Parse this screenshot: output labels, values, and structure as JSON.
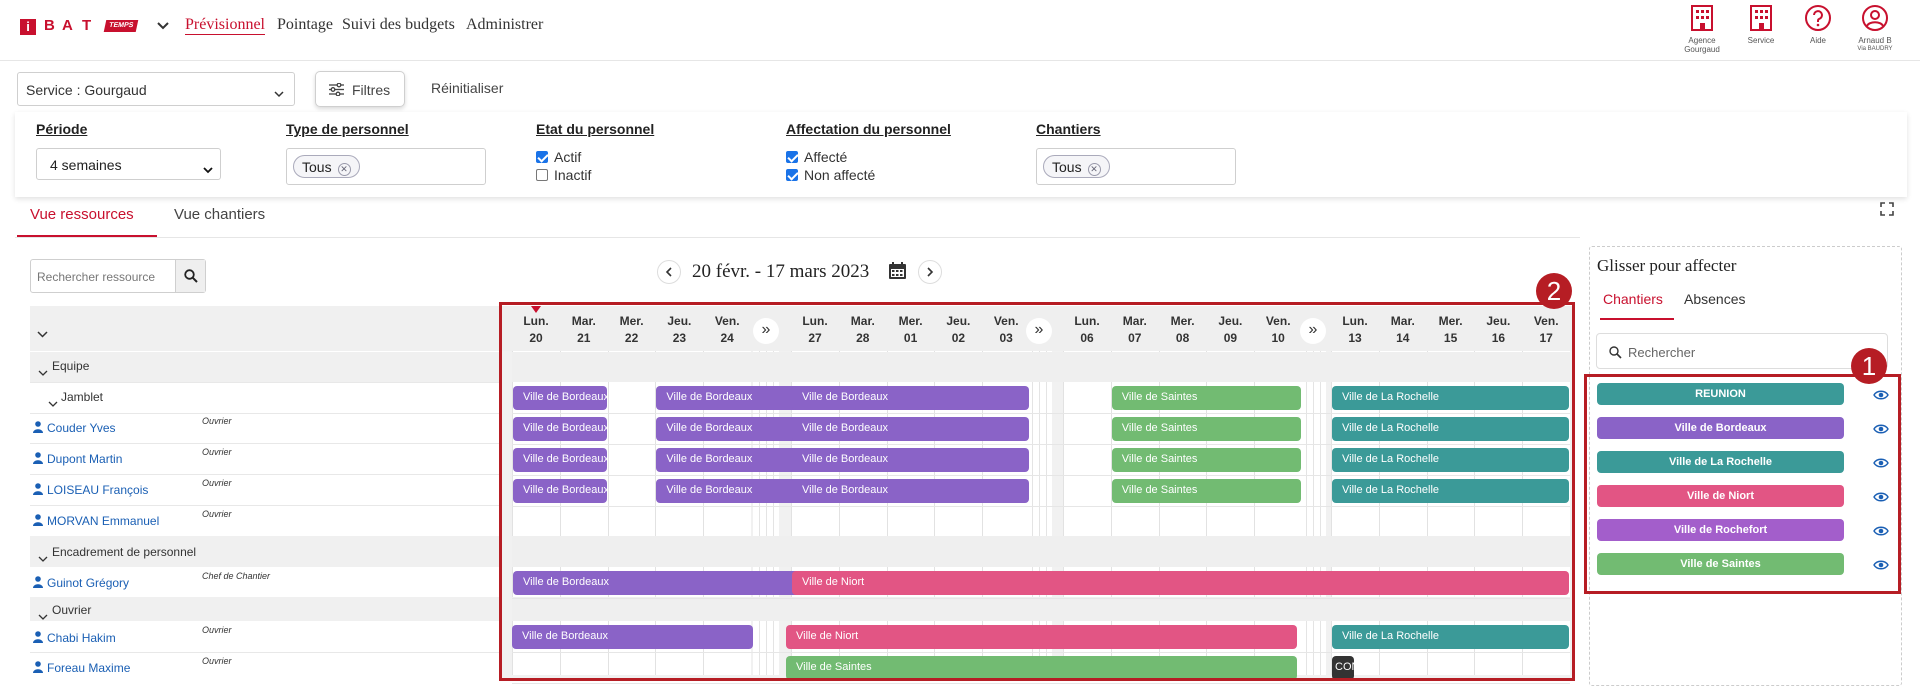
{
  "header": {
    "logo_letters": [
      "i",
      "B",
      "A",
      "T"
    ],
    "logo_tag": "TEMPS",
    "nav": [
      {
        "label": "Prévisionnel",
        "active": true
      },
      {
        "label": "Pointage"
      },
      {
        "label": "Suivi des budgets"
      },
      {
        "label": "Administrer"
      }
    ],
    "icons": [
      {
        "name": "building-icon",
        "label_lines": [
          "Agence",
          "Gourgaud"
        ]
      },
      {
        "name": "building-icon",
        "label_lines": [
          "Service",
          ""
        ]
      },
      {
        "name": "help-icon",
        "label_lines": [
          "Aide",
          ""
        ]
      },
      {
        "name": "user-icon",
        "label_lines": [
          "Arnaud B",
          "Via BAUDRY"
        ]
      }
    ]
  },
  "filters": {
    "service_select": "Service : Gourgaud",
    "filter_button": "Filtres",
    "reset_button": "Réinitialiser",
    "periode": {
      "label": "Période",
      "value": "4 semaines"
    },
    "type_personnel": {
      "label": "Type de personnel",
      "chip": "Tous"
    },
    "etat_personnel": {
      "label": "Etat du personnel",
      "options": [
        {
          "label": "Actif",
          "checked": true
        },
        {
          "label": "Inactif",
          "checked": false
        }
      ]
    },
    "affectation": {
      "label": "Affectation du personnel",
      "options": [
        {
          "label": "Affecté",
          "checked": true
        },
        {
          "label": "Non affecté",
          "checked": true
        }
      ]
    },
    "chantiers": {
      "label": "Chantiers",
      "chip": "Tous"
    }
  },
  "tabs": [
    {
      "label": "Vue ressources",
      "active": true
    },
    {
      "label": "Vue chantiers"
    }
  ],
  "resources": {
    "search_placeholder": "Rechercher ressource",
    "groups": [
      {
        "label": "Equipe"
      },
      {
        "label": "Jamblet"
      },
      {
        "label": "Encadrement de personnel"
      },
      {
        "label": "Ouvrier"
      }
    ],
    "people": [
      {
        "name": "Couder Yves",
        "role": "Ouvrier"
      },
      {
        "name": "Dupont Martin",
        "role": "Ouvrier"
      },
      {
        "name": "LOISEAU François",
        "role": "Ouvrier"
      },
      {
        "name": "MORVAN Emmanuel",
        "role": "Ouvrier"
      },
      {
        "name": "Guinot Grégory",
        "role": "Chef de Chantier"
      },
      {
        "name": "Chabi Hakim",
        "role": "Ouvrier"
      },
      {
        "name": "Foreau Maxime",
        "role": "Ouvrier"
      }
    ]
  },
  "calendar": {
    "range_title": "20 févr. - 17 mars 2023",
    "weeks": [
      {
        "days": [
          {
            "d": "Lun.",
            "n": "20"
          },
          {
            "d": "Mar.",
            "n": "21"
          },
          {
            "d": "Mer.",
            "n": "22"
          },
          {
            "d": "Jeu.",
            "n": "23"
          },
          {
            "d": "Ven.",
            "n": "24"
          }
        ]
      },
      {
        "days": [
          {
            "d": "Lun.",
            "n": "27"
          },
          {
            "d": "Mar.",
            "n": "28"
          },
          {
            "d": "Mer.",
            "n": "01"
          },
          {
            "d": "Jeu.",
            "n": "02"
          },
          {
            "d": "Ven.",
            "n": "03"
          }
        ]
      },
      {
        "days": [
          {
            "d": "Lun.",
            "n": "06"
          },
          {
            "d": "Mar.",
            "n": "07"
          },
          {
            "d": "Mer.",
            "n": "08"
          },
          {
            "d": "Jeu.",
            "n": "09"
          },
          {
            "d": "Ven.",
            "n": "10"
          }
        ]
      },
      {
        "days": [
          {
            "d": "Lun.",
            "n": "13"
          },
          {
            "d": "Mar.",
            "n": "14"
          },
          {
            "d": "Mer.",
            "n": "15"
          },
          {
            "d": "Jeu.",
            "n": "16"
          },
          {
            "d": "Ven.",
            "n": "17"
          }
        ]
      }
    ],
    "annotation_grid": "2",
    "assignments": [
      {
        "row": 0,
        "label": "Ville de Bordeaux",
        "color": "#8a63c7",
        "from": [
          0,
          0
        ],
        "to": [
          0,
          1
        ]
      },
      {
        "row": 0,
        "label": "Ville de Bordeaux",
        "color": "#8a63c7",
        "from": [
          0,
          3
        ],
        "to": [
          1,
          0
        ]
      },
      {
        "row": 0,
        "label": "Ville de Bordeaux",
        "color": "#8a63c7",
        "from": [
          1,
          0
        ],
        "to": [
          1,
          4
        ]
      },
      {
        "row": 0,
        "label": "Ville de Saintes",
        "color": "#72bb72",
        "from": [
          2,
          1
        ],
        "to": [
          2,
          4
        ]
      },
      {
        "row": 0,
        "label": "Ville de La Rochelle",
        "color": "#3b9a98",
        "from": [
          3,
          0
        ],
        "to": [
          3,
          4
        ]
      },
      {
        "row": 1,
        "label": "Ville de Bordeaux",
        "color": "#8a63c7",
        "from": [
          0,
          0
        ],
        "to": [
          0,
          1
        ]
      },
      {
        "row": 1,
        "label": "Ville de Bordeaux",
        "color": "#8a63c7",
        "from": [
          0,
          3
        ],
        "to": [
          1,
          0
        ]
      },
      {
        "row": 1,
        "label": "Ville de Bordeaux",
        "color": "#8a63c7",
        "from": [
          1,
          0
        ],
        "to": [
          1,
          4
        ]
      },
      {
        "row": 1,
        "label": "Ville de Saintes",
        "color": "#72bb72",
        "from": [
          2,
          1
        ],
        "to": [
          2,
          4
        ]
      },
      {
        "row": 1,
        "label": "Ville de La Rochelle",
        "color": "#3b9a98",
        "from": [
          3,
          0
        ],
        "to": [
          3,
          4
        ]
      },
      {
        "row": 2,
        "label": "Ville de Bordeaux",
        "color": "#8a63c7",
        "from": [
          0,
          0
        ],
        "to": [
          0,
          1
        ]
      },
      {
        "row": 2,
        "label": "Ville de Bordeaux",
        "color": "#8a63c7",
        "from": [
          0,
          3
        ],
        "to": [
          1,
          0
        ]
      },
      {
        "row": 2,
        "label": "Ville de Bordeaux",
        "color": "#8a63c7",
        "from": [
          1,
          0
        ],
        "to": [
          1,
          4
        ]
      },
      {
        "row": 2,
        "label": "Ville de Saintes",
        "color": "#72bb72",
        "from": [
          2,
          1
        ],
        "to": [
          2,
          4
        ]
      },
      {
        "row": 2,
        "label": "Ville de La Rochelle",
        "color": "#3b9a98",
        "from": [
          3,
          0
        ],
        "to": [
          3,
          4
        ]
      },
      {
        "row": 3,
        "label": "Ville de Bordeaux",
        "color": "#8a63c7",
        "from": [
          0,
          0
        ],
        "to": [
          0,
          1
        ]
      },
      {
        "row": 3,
        "label": "Ville de Bordeaux",
        "color": "#8a63c7",
        "from": [
          0,
          3
        ],
        "to": [
          1,
          0
        ]
      },
      {
        "row": 3,
        "label": "Ville de Bordeaux",
        "color": "#8a63c7",
        "from": [
          1,
          0
        ],
        "to": [
          1,
          4
        ]
      },
      {
        "row": 3,
        "label": "Ville de Saintes",
        "color": "#72bb72",
        "from": [
          2,
          1
        ],
        "to": [
          2,
          4
        ]
      },
      {
        "row": 3,
        "label": "Ville de La Rochelle",
        "color": "#3b9a98",
        "from": [
          3,
          0
        ],
        "to": [
          3,
          4
        ]
      },
      {
        "row": 4,
        "label": "Ville de Bordeaux",
        "color": "#8a63c7",
        "from": [
          0,
          0
        ],
        "to": [
          1,
          0
        ]
      },
      {
        "row": 4,
        "label": "Ville de Niort",
        "color": "#e25584",
        "from": [
          1,
          0
        ],
        "to": [
          3,
          4
        ]
      },
      {
        "row": 5,
        "label": "Ville de Bordeaux",
        "color": "#8a63c7",
        "from": [
          0,
          0
        ],
        "to": [
          0,
          4
        ]
      },
      {
        "row": 5,
        "label": "Ville de Niort",
        "color": "#e25584",
        "from": [
          1,
          0
        ],
        "to": [
          2,
          4
        ]
      },
      {
        "row": 5,
        "label": "Ville de La Rochelle",
        "color": "#3b9a98",
        "from": [
          3,
          0
        ],
        "to": [
          3,
          4
        ]
      },
      {
        "row": 6,
        "label": "Ville de Saintes",
        "color": "#72bb72",
        "from": [
          1,
          0
        ],
        "to": [
          2,
          4
        ]
      },
      {
        "row": 6,
        "label": "CON",
        "color": "#333333",
        "from": [
          3,
          0
        ],
        "to": [
          3,
          0
        ]
      }
    ]
  },
  "right_panel": {
    "title": "Glisser pour affecter",
    "tabs": [
      {
        "label": "Chantiers",
        "active": true
      },
      {
        "label": "Absences"
      }
    ],
    "search_placeholder": "Rechercher",
    "annotation_list": "1",
    "chantiers": [
      {
        "label": "REUNION",
        "color": "#3b9a98"
      },
      {
        "label": "Ville de Bordeaux",
        "color": "#8a63c7"
      },
      {
        "label": "Ville de La Rochelle",
        "color": "#3b9a98"
      },
      {
        "label": "Ville de Niort",
        "color": "#e25584"
      },
      {
        "label": "Ville de Rochefort",
        "color": "#a35ecb"
      },
      {
        "label": "Ville de Saintes",
        "color": "#72bb72"
      }
    ]
  }
}
